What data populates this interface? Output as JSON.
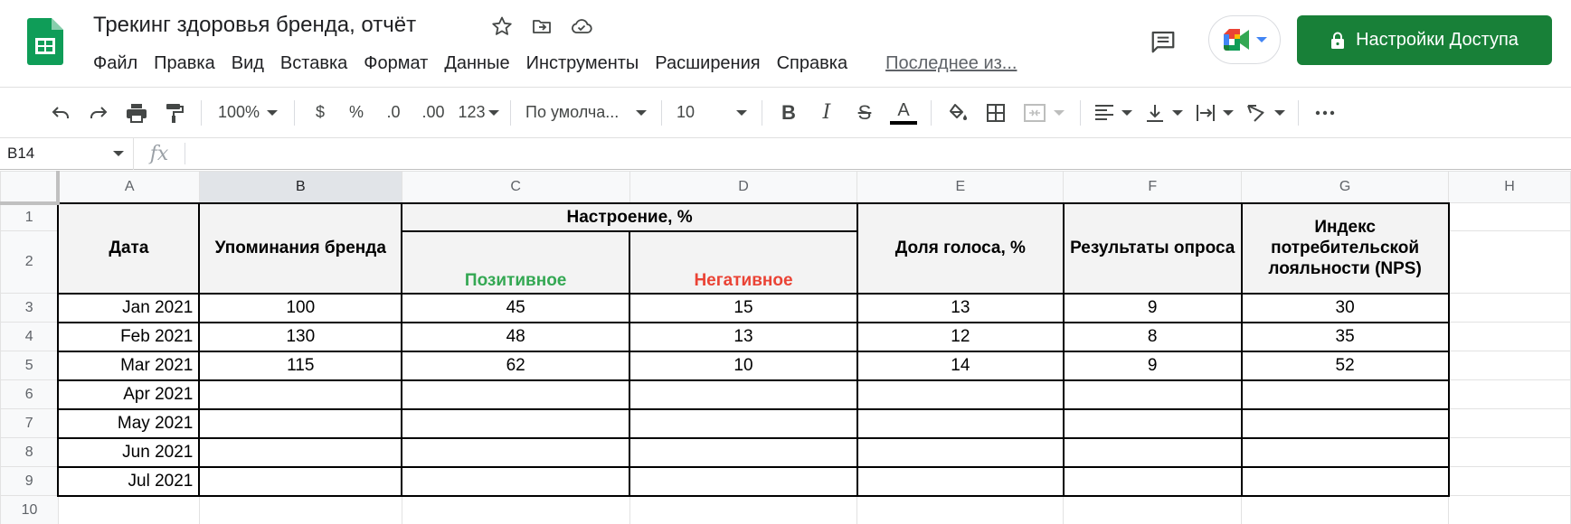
{
  "app": {
    "name": "Google Sheets",
    "brand_color": "#0f9d58",
    "accent": "#188038"
  },
  "doc": {
    "title": "Трекинг здоровья бренда, отчёт"
  },
  "menu": {
    "items": [
      "Файл",
      "Правка",
      "Вид",
      "Вставка",
      "Формат",
      "Данные",
      "Инструменты",
      "Расширения",
      "Справка"
    ],
    "last_edit": "Последнее из..."
  },
  "share": {
    "label": "Настройки Доступа"
  },
  "toolbar": {
    "zoom": "100%",
    "currency": "$",
    "percent": "%",
    "dec_decrease": ".0",
    "dec_increase": ".00",
    "more_formats": "123",
    "font": "По умолча...",
    "font_size": "10",
    "bold": "B",
    "italic": "I",
    "strike": "S",
    "text_color": "A"
  },
  "formula_bar": {
    "name_box": "B14",
    "fx": "fx",
    "value": ""
  },
  "columns": [
    "A",
    "B",
    "C",
    "D",
    "E",
    "F",
    "G",
    "H"
  ],
  "selected_column": "B",
  "rows": [
    "1",
    "2",
    "3",
    "4",
    "5",
    "6",
    "7",
    "8",
    "9",
    "10"
  ],
  "table": {
    "headers": {
      "date": "Дата",
      "mentions": "Упоминания бренда",
      "sentiment": "Настроение, %",
      "positive": "Позитивное",
      "negative": "Негативное",
      "share_of_voice": "Доля голоса, %",
      "survey": "Результаты опроса",
      "nps": "Индекс потребительской лояльности (NPS)"
    },
    "data": [
      {
        "date": "Jan 2021",
        "mentions": "100",
        "positive": "45",
        "negative": "15",
        "share": "13",
        "survey": "9",
        "nps": "30"
      },
      {
        "date": "Feb 2021",
        "mentions": "130",
        "positive": "48",
        "negative": "13",
        "share": "12",
        "survey": "8",
        "nps": "35"
      },
      {
        "date": "Mar 2021",
        "mentions": "115",
        "positive": "62",
        "negative": "10",
        "share": "14",
        "survey": "9",
        "nps": "52"
      },
      {
        "date": "Apr 2021",
        "mentions": "",
        "positive": "",
        "negative": "",
        "share": "",
        "survey": "",
        "nps": ""
      },
      {
        "date": "May 2021",
        "mentions": "",
        "positive": "",
        "negative": "",
        "share": "",
        "survey": "",
        "nps": ""
      },
      {
        "date": "Jun 2021",
        "mentions": "",
        "positive": "",
        "negative": "",
        "share": "",
        "survey": "",
        "nps": ""
      },
      {
        "date": "Jul 2021",
        "mentions": "",
        "positive": "",
        "negative": "",
        "share": "",
        "survey": "",
        "nps": ""
      }
    ]
  },
  "colors": {
    "positive": "#34a853",
    "negative": "#ea4335",
    "header_fill": "#f3f3f3"
  }
}
